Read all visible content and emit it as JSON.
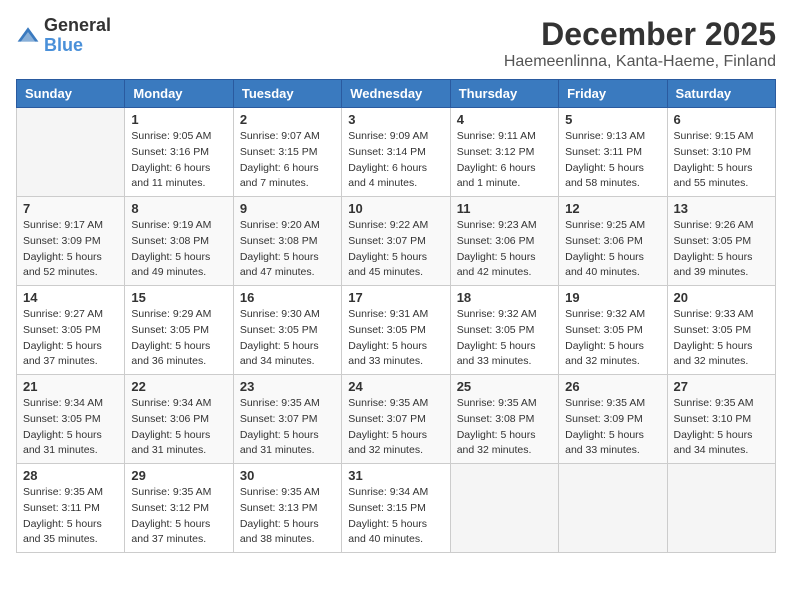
{
  "header": {
    "logo_general": "General",
    "logo_blue": "Blue",
    "month": "December 2025",
    "location": "Haemeenlinna, Kanta-Haeme, Finland"
  },
  "weekdays": [
    "Sunday",
    "Monday",
    "Tuesday",
    "Wednesday",
    "Thursday",
    "Friday",
    "Saturday"
  ],
  "weeks": [
    [
      {
        "day": "",
        "sunrise": "",
        "sunset": "",
        "daylight": ""
      },
      {
        "day": "1",
        "sunrise": "Sunrise: 9:05 AM",
        "sunset": "Sunset: 3:16 PM",
        "daylight": "Daylight: 6 hours and 11 minutes."
      },
      {
        "day": "2",
        "sunrise": "Sunrise: 9:07 AM",
        "sunset": "Sunset: 3:15 PM",
        "daylight": "Daylight: 6 hours and 7 minutes."
      },
      {
        "day": "3",
        "sunrise": "Sunrise: 9:09 AM",
        "sunset": "Sunset: 3:14 PM",
        "daylight": "Daylight: 6 hours and 4 minutes."
      },
      {
        "day": "4",
        "sunrise": "Sunrise: 9:11 AM",
        "sunset": "Sunset: 3:12 PM",
        "daylight": "Daylight: 6 hours and 1 minute."
      },
      {
        "day": "5",
        "sunrise": "Sunrise: 9:13 AM",
        "sunset": "Sunset: 3:11 PM",
        "daylight": "Daylight: 5 hours and 58 minutes."
      },
      {
        "day": "6",
        "sunrise": "Sunrise: 9:15 AM",
        "sunset": "Sunset: 3:10 PM",
        "daylight": "Daylight: 5 hours and 55 minutes."
      }
    ],
    [
      {
        "day": "7",
        "sunrise": "Sunrise: 9:17 AM",
        "sunset": "Sunset: 3:09 PM",
        "daylight": "Daylight: 5 hours and 52 minutes."
      },
      {
        "day": "8",
        "sunrise": "Sunrise: 9:19 AM",
        "sunset": "Sunset: 3:08 PM",
        "daylight": "Daylight: 5 hours and 49 minutes."
      },
      {
        "day": "9",
        "sunrise": "Sunrise: 9:20 AM",
        "sunset": "Sunset: 3:08 PM",
        "daylight": "Daylight: 5 hours and 47 minutes."
      },
      {
        "day": "10",
        "sunrise": "Sunrise: 9:22 AM",
        "sunset": "Sunset: 3:07 PM",
        "daylight": "Daylight: 5 hours and 45 minutes."
      },
      {
        "day": "11",
        "sunrise": "Sunrise: 9:23 AM",
        "sunset": "Sunset: 3:06 PM",
        "daylight": "Daylight: 5 hours and 42 minutes."
      },
      {
        "day": "12",
        "sunrise": "Sunrise: 9:25 AM",
        "sunset": "Sunset: 3:06 PM",
        "daylight": "Daylight: 5 hours and 40 minutes."
      },
      {
        "day": "13",
        "sunrise": "Sunrise: 9:26 AM",
        "sunset": "Sunset: 3:05 PM",
        "daylight": "Daylight: 5 hours and 39 minutes."
      }
    ],
    [
      {
        "day": "14",
        "sunrise": "Sunrise: 9:27 AM",
        "sunset": "Sunset: 3:05 PM",
        "daylight": "Daylight: 5 hours and 37 minutes."
      },
      {
        "day": "15",
        "sunrise": "Sunrise: 9:29 AM",
        "sunset": "Sunset: 3:05 PM",
        "daylight": "Daylight: 5 hours and 36 minutes."
      },
      {
        "day": "16",
        "sunrise": "Sunrise: 9:30 AM",
        "sunset": "Sunset: 3:05 PM",
        "daylight": "Daylight: 5 hours and 34 minutes."
      },
      {
        "day": "17",
        "sunrise": "Sunrise: 9:31 AM",
        "sunset": "Sunset: 3:05 PM",
        "daylight": "Daylight: 5 hours and 33 minutes."
      },
      {
        "day": "18",
        "sunrise": "Sunrise: 9:32 AM",
        "sunset": "Sunset: 3:05 PM",
        "daylight": "Daylight: 5 hours and 33 minutes."
      },
      {
        "day": "19",
        "sunrise": "Sunrise: 9:32 AM",
        "sunset": "Sunset: 3:05 PM",
        "daylight": "Daylight: 5 hours and 32 minutes."
      },
      {
        "day": "20",
        "sunrise": "Sunrise: 9:33 AM",
        "sunset": "Sunset: 3:05 PM",
        "daylight": "Daylight: 5 hours and 32 minutes."
      }
    ],
    [
      {
        "day": "21",
        "sunrise": "Sunrise: 9:34 AM",
        "sunset": "Sunset: 3:05 PM",
        "daylight": "Daylight: 5 hours and 31 minutes."
      },
      {
        "day": "22",
        "sunrise": "Sunrise: 9:34 AM",
        "sunset": "Sunset: 3:06 PM",
        "daylight": "Daylight: 5 hours and 31 minutes."
      },
      {
        "day": "23",
        "sunrise": "Sunrise: 9:35 AM",
        "sunset": "Sunset: 3:07 PM",
        "daylight": "Daylight: 5 hours and 31 minutes."
      },
      {
        "day": "24",
        "sunrise": "Sunrise: 9:35 AM",
        "sunset": "Sunset: 3:07 PM",
        "daylight": "Daylight: 5 hours and 32 minutes."
      },
      {
        "day": "25",
        "sunrise": "Sunrise: 9:35 AM",
        "sunset": "Sunset: 3:08 PM",
        "daylight": "Daylight: 5 hours and 32 minutes."
      },
      {
        "day": "26",
        "sunrise": "Sunrise: 9:35 AM",
        "sunset": "Sunset: 3:09 PM",
        "daylight": "Daylight: 5 hours and 33 minutes."
      },
      {
        "day": "27",
        "sunrise": "Sunrise: 9:35 AM",
        "sunset": "Sunset: 3:10 PM",
        "daylight": "Daylight: 5 hours and 34 minutes."
      }
    ],
    [
      {
        "day": "28",
        "sunrise": "Sunrise: 9:35 AM",
        "sunset": "Sunset: 3:11 PM",
        "daylight": "Daylight: 5 hours and 35 minutes."
      },
      {
        "day": "29",
        "sunrise": "Sunrise: 9:35 AM",
        "sunset": "Sunset: 3:12 PM",
        "daylight": "Daylight: 5 hours and 37 minutes."
      },
      {
        "day": "30",
        "sunrise": "Sunrise: 9:35 AM",
        "sunset": "Sunset: 3:13 PM",
        "daylight": "Daylight: 5 hours and 38 minutes."
      },
      {
        "day": "31",
        "sunrise": "Sunrise: 9:34 AM",
        "sunset": "Sunset: 3:15 PM",
        "daylight": "Daylight: 5 hours and 40 minutes."
      },
      {
        "day": "",
        "sunrise": "",
        "sunset": "",
        "daylight": ""
      },
      {
        "day": "",
        "sunrise": "",
        "sunset": "",
        "daylight": ""
      },
      {
        "day": "",
        "sunrise": "",
        "sunset": "",
        "daylight": ""
      }
    ]
  ]
}
